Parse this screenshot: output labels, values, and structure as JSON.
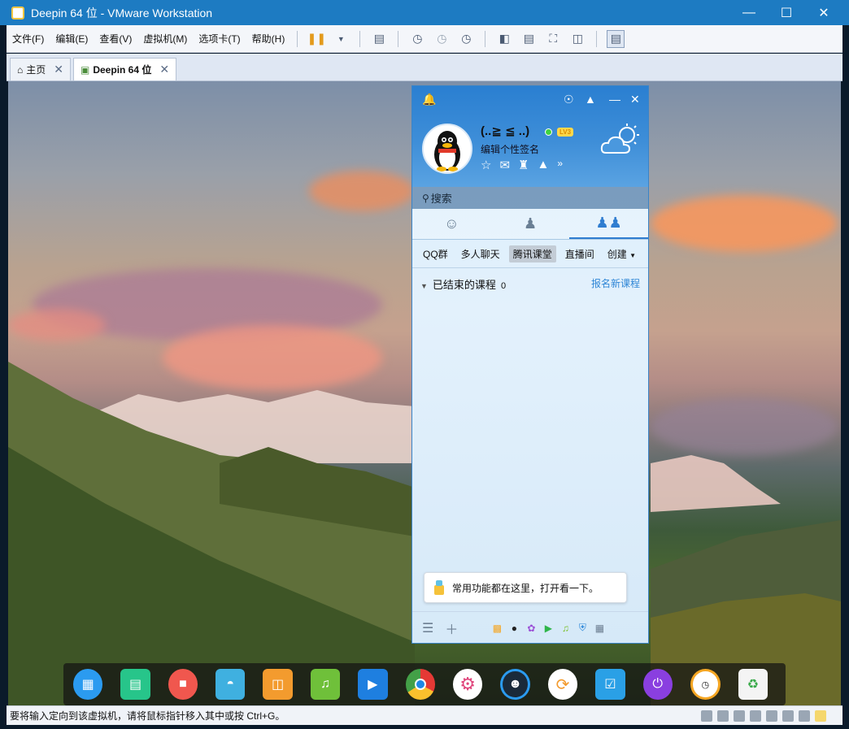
{
  "window": {
    "title": "Deepin 64 位 - VMware Workstation"
  },
  "menu": [
    "文件(F)",
    "编辑(E)",
    "查看(V)",
    "虚拟机(M)",
    "选项卡(T)",
    "帮助(H)"
  ],
  "tabs": [
    {
      "label": "主页"
    },
    {
      "label": "Deepin 64 位"
    }
  ],
  "qq": {
    "nickname": "(..≧ ≦ ..)",
    "level": "LV3",
    "signature": "编辑个性签名",
    "search_placeholder": "搜索",
    "subtabs": [
      "QQ群",
      "多人聊天",
      "腾讯课堂",
      "直播间",
      "创建"
    ],
    "active_subtab": "腾讯课堂",
    "section_title": "已结束的课程",
    "section_count": "0",
    "signup_link": "报名新课程",
    "tip": "常用功能都在这里，打开看一下。"
  },
  "dock_icons": [
    "launcher-icon",
    "terminal-icon",
    "screen-recorder-icon",
    "archive-manager-icon",
    "app-store-icon",
    "music-icon",
    "video-icon",
    "chrome-icon",
    "settings-icon",
    "qq-assistant-icon",
    "refresh-icon",
    "screenshot-icon",
    "power-icon",
    "clock-icon",
    "trash-icon"
  ],
  "status": {
    "text": "要将输入定向到该虚拟机，请将鼠标指针移入其中或按 Ctrl+G。"
  },
  "colors": {
    "titlebar": "#1d7bc2",
    "qq_header": "#2a7fd1",
    "link": "#2f86d6"
  }
}
